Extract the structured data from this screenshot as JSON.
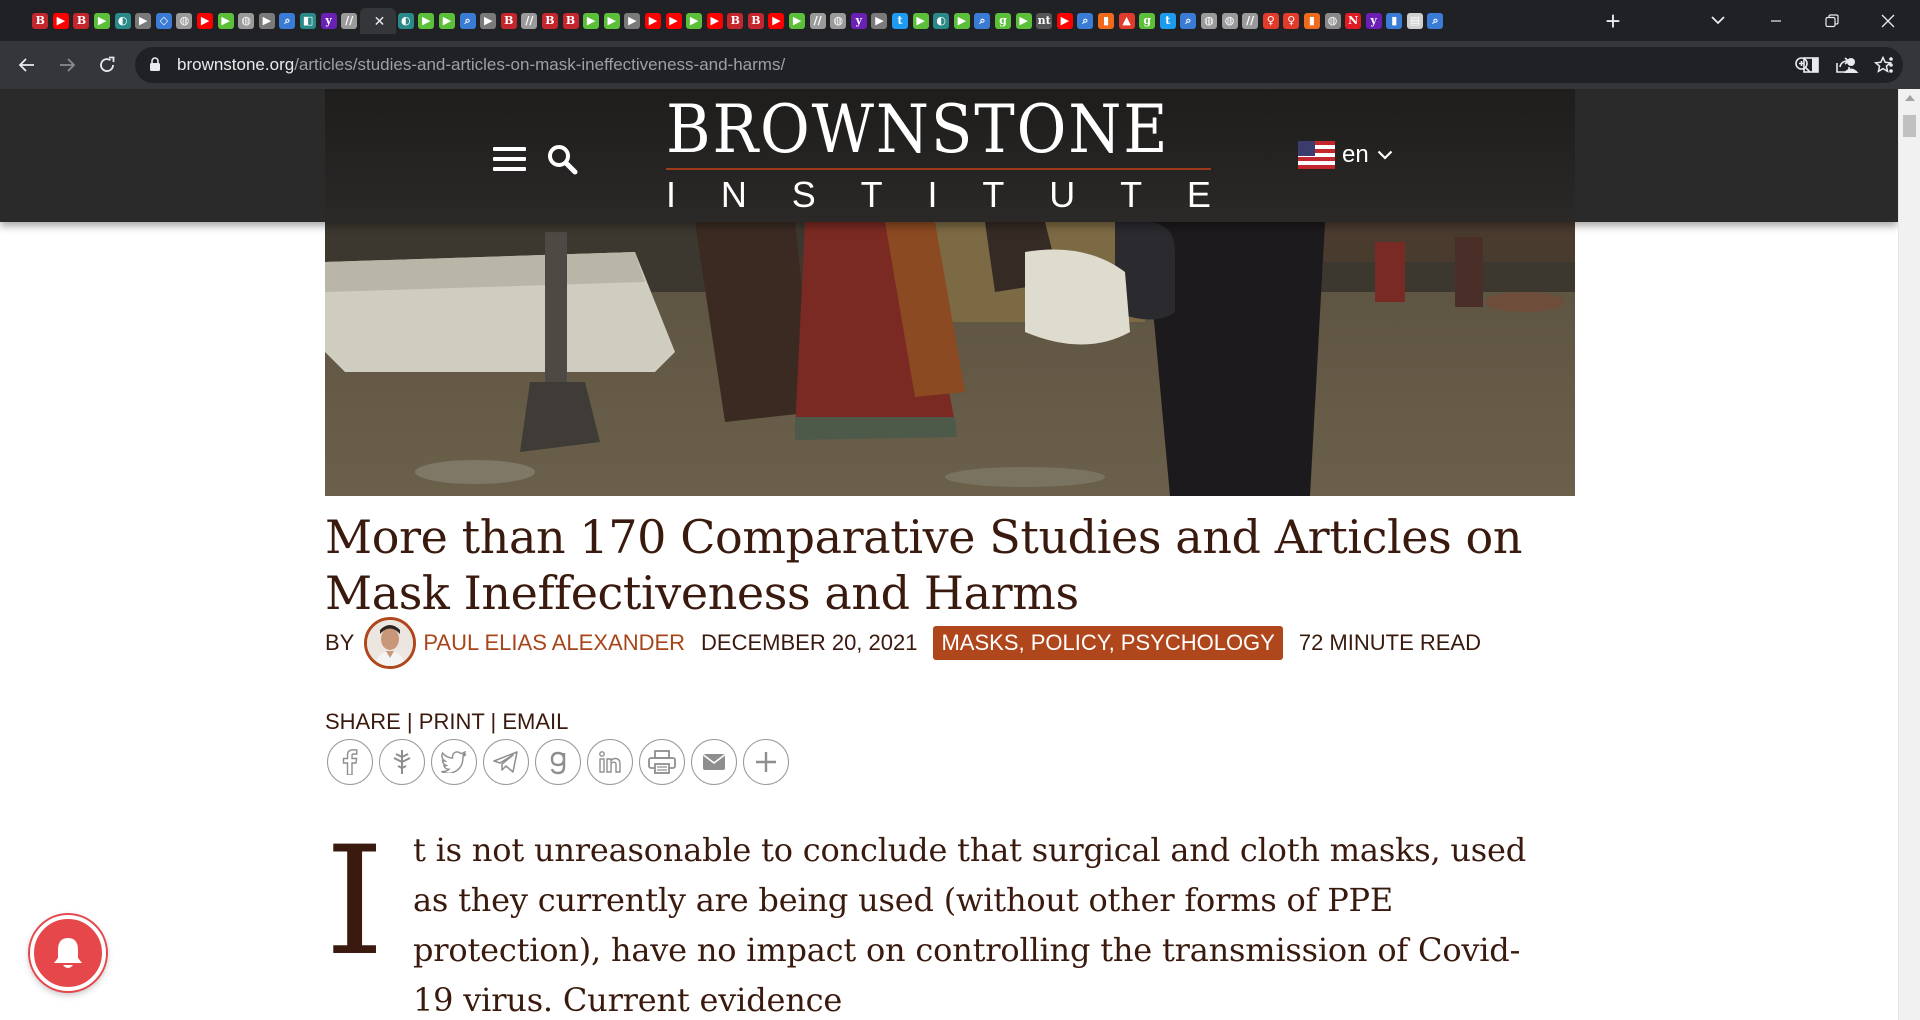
{
  "browser": {
    "tab_favicons": [
      {
        "glyph": "B",
        "color": "#c4262e"
      },
      {
        "glyph": "▶",
        "color": "#ff0000"
      },
      {
        "glyph": "B",
        "color": "#c4262e"
      },
      {
        "glyph": "▶",
        "color": "#5bbf3a"
      },
      {
        "glyph": "◐",
        "color": "#2a8a8a"
      },
      {
        "glyph": "▶",
        "color": "#7a7a7a"
      },
      {
        "glyph": "◇",
        "color": "#3a7bd5"
      },
      {
        "glyph": "◍",
        "color": "#9a9a9a"
      },
      {
        "glyph": "▶",
        "color": "#ff0000"
      },
      {
        "glyph": "▶",
        "color": "#5bbf3a"
      },
      {
        "glyph": "◍",
        "color": "#9a9a9a"
      },
      {
        "glyph": "▶",
        "color": "#7a7a7a"
      },
      {
        "glyph": "⌕",
        "color": "#3a7bd5"
      },
      {
        "glyph": "◧",
        "color": "#2a8a8a"
      },
      {
        "glyph": "y",
        "color": "#6a1fb5"
      },
      {
        "glyph": "//",
        "color": "#9a9a9a"
      }
    ],
    "tab_favicons_2": [
      {
        "glyph": "◐",
        "color": "#2a8a8a"
      },
      {
        "glyph": "▶",
        "color": "#5bbf3a"
      },
      {
        "glyph": "▶",
        "color": "#5bbf3a"
      },
      {
        "glyph": "⌕",
        "color": "#3a7bd5"
      },
      {
        "glyph": "▶",
        "color": "#7a7a7a"
      },
      {
        "glyph": "B",
        "color": "#c4262e"
      },
      {
        "glyph": "//",
        "color": "#9a9a9a"
      },
      {
        "glyph": "B",
        "color": "#c4262e"
      },
      {
        "glyph": "B",
        "color": "#c4262e"
      },
      {
        "glyph": "▶",
        "color": "#5bbf3a"
      },
      {
        "glyph": "▶",
        "color": "#5bbf3a"
      },
      {
        "glyph": "▶",
        "color": "#7a7a7a"
      },
      {
        "glyph": "▶",
        "color": "#ff0000"
      },
      {
        "glyph": "▶",
        "color": "#ff0000"
      },
      {
        "glyph": "▶",
        "color": "#5bbf3a"
      },
      {
        "glyph": "▶",
        "color": "#ff0000"
      },
      {
        "glyph": "B",
        "color": "#c4262e"
      },
      {
        "glyph": "B",
        "color": "#c4262e"
      },
      {
        "glyph": "▶",
        "color": "#ff0000"
      },
      {
        "glyph": "▶",
        "color": "#5bbf3a"
      },
      {
        "glyph": "//",
        "color": "#9a9a9a"
      },
      {
        "glyph": "◍",
        "color": "#9a9a9a"
      },
      {
        "glyph": "y",
        "color": "#6a1fb5"
      },
      {
        "glyph": "▶",
        "color": "#7a7a7a"
      },
      {
        "glyph": "t",
        "color": "#1d9bf0"
      },
      {
        "glyph": "▶",
        "color": "#5bbf3a"
      },
      {
        "glyph": "◐",
        "color": "#2a8a8a"
      },
      {
        "glyph": "▶",
        "color": "#5bbf3a"
      },
      {
        "glyph": "⌕",
        "color": "#3a7bd5"
      },
      {
        "glyph": "g",
        "color": "#5bbf3a"
      },
      {
        "glyph": "▶",
        "color": "#5bbf3a"
      },
      {
        "glyph": "nt",
        "color": "#555555"
      },
      {
        "glyph": "▶",
        "color": "#ff0000"
      },
      {
        "glyph": "⌕",
        "color": "#3a7bd5"
      },
      {
        "glyph": "▮",
        "color": "#f06a1e"
      },
      {
        "glyph": "▲",
        "color": "#e03b2b"
      },
      {
        "glyph": "g",
        "color": "#5bbf3a"
      },
      {
        "glyph": "t",
        "color": "#1d9bf0"
      },
      {
        "glyph": "⌕",
        "color": "#3a7bd5"
      },
      {
        "glyph": "◍",
        "color": "#9a9a9a"
      },
      {
        "glyph": "◍",
        "color": "#9a9a9a"
      },
      {
        "glyph": "//",
        "color": "#9a9a9a"
      },
      {
        "glyph": "♀",
        "color": "#e03b2b"
      },
      {
        "glyph": "♀",
        "color": "#e03b2b"
      },
      {
        "glyph": "▮",
        "color": "#f06a1e"
      },
      {
        "glyph": "◍",
        "color": "#8a8a8a"
      },
      {
        "glyph": "N",
        "color": "#e01b24"
      },
      {
        "glyph": "y",
        "color": "#6a1fb5"
      },
      {
        "glyph": "▮",
        "color": "#3a7bd5"
      },
      {
        "glyph": "▤",
        "color": "#cfcfcf"
      },
      {
        "glyph": "⌕",
        "color": "#3a7bd5"
      }
    ],
    "url_host": "brownstone.org",
    "url_path": "/articles/studies-and-articles-on-mask-ineffectiveness-and-harms/"
  },
  "site": {
    "logo_top": "BROWNSTONE",
    "logo_bottom": [
      "I",
      "N",
      "S",
      "T",
      "I",
      "T",
      "U",
      "T",
      "E"
    ],
    "language": "en"
  },
  "article": {
    "title": "More than 170 Comparative Studies and Articles on Mask Ineffectiveness and Harms",
    "by": "BY",
    "author": "PAUL ELIAS ALEXANDER",
    "date": "DECEMBER 20, 2021",
    "tags": "MASKS, POLICY, PSYCHOLOGY",
    "read_time": "72 MINUTE READ",
    "share": "SHARE",
    "print": "PRINT",
    "email": "EMAIL",
    "separator": "|",
    "dropcap": "I",
    "first_paragraph": "t is not unreasonable to conclude that surgical and cloth masks, used as they currently are being used (without other forms of PPE protection), have no impact on controlling the transmission of Covid-19 virus. Current evidence"
  },
  "share_icons": [
    "facebook-icon",
    "gettr-icon",
    "twitter-icon",
    "telegram-icon",
    "gab-icon",
    "linkedin-icon",
    "print-icon",
    "email-icon",
    "more-icon"
  ],
  "colors": {
    "brand_brown": "#3a1a0e",
    "accent_rust": "#b0461c",
    "notification_red": "#e5474b"
  }
}
